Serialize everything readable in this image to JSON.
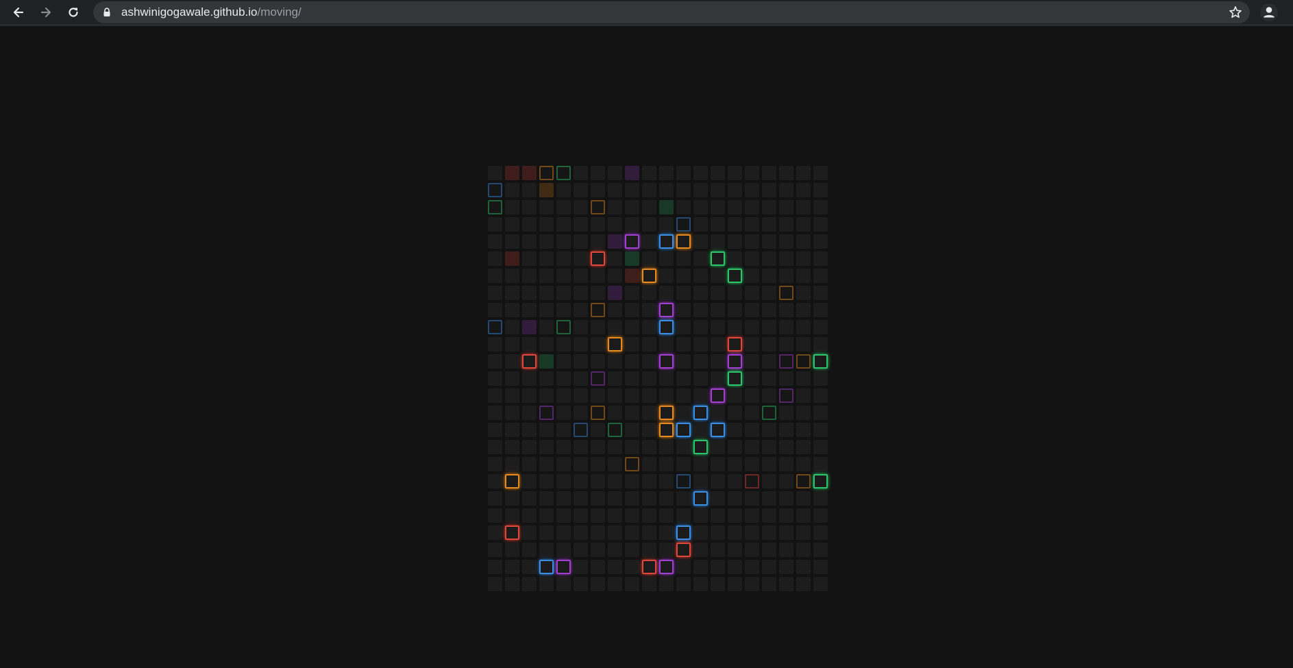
{
  "browser": {
    "url_host": "ashwinigogawale.github.io",
    "url_path": "/moving/",
    "icons": {
      "back": "back-arrow-icon",
      "forward": "forward-arrow-icon",
      "reload": "reload-icon",
      "lock": "lock-icon",
      "bookmark": "star-icon",
      "profile": "profile-icon"
    }
  },
  "grid": {
    "columns": 20,
    "rows": 25,
    "colors": {
      "r": "#e0463a",
      "o": "#e58a1f",
      "g": "#2ec56a",
      "b": "#3b8ee6",
      "p": "#a23fd0",
      "base": "#1d1d1d"
    },
    "cells": [
      [
        1,
        0,
        "r",
        "faint"
      ],
      [
        2,
        0,
        "r",
        "faint"
      ],
      [
        3,
        0,
        "o",
        "dim"
      ],
      [
        4,
        0,
        "g",
        "dim"
      ],
      [
        8,
        0,
        "p",
        "faint"
      ],
      [
        0,
        1,
        "b",
        "dim"
      ],
      [
        3,
        1,
        "o",
        "faint"
      ],
      [
        0,
        2,
        "g",
        "dim"
      ],
      [
        6,
        2,
        "o",
        "dim"
      ],
      [
        10,
        2,
        "g",
        "faint"
      ],
      [
        11,
        3,
        "b",
        "dim"
      ],
      [
        7,
        4,
        "p",
        "faint"
      ],
      [
        8,
        4,
        "p",
        "lit"
      ],
      [
        10,
        4,
        "b",
        "lit"
      ],
      [
        11,
        4,
        "o",
        "lit"
      ],
      [
        1,
        5,
        "r",
        "faint"
      ],
      [
        6,
        5,
        "r",
        "lit"
      ],
      [
        8,
        5,
        "g",
        "faint"
      ],
      [
        13,
        5,
        "g",
        "lit"
      ],
      [
        8,
        6,
        "r",
        "faint"
      ],
      [
        9,
        6,
        "o",
        "lit"
      ],
      [
        14,
        6,
        "g",
        "lit"
      ],
      [
        7,
        7,
        "p",
        "faint"
      ],
      [
        17,
        7,
        "o",
        "dim"
      ],
      [
        6,
        8,
        "o",
        "dim"
      ],
      [
        10,
        8,
        "p",
        "lit"
      ],
      [
        0,
        9,
        "b",
        "dim"
      ],
      [
        2,
        9,
        "p",
        "faint"
      ],
      [
        4,
        9,
        "g",
        "dim"
      ],
      [
        10,
        9,
        "b",
        "lit"
      ],
      [
        7,
        10,
        "o",
        "lit"
      ],
      [
        14,
        10,
        "r",
        "lit"
      ],
      [
        2,
        11,
        "r",
        "lit"
      ],
      [
        3,
        11,
        "g",
        "faint"
      ],
      [
        10,
        11,
        "p",
        "lit"
      ],
      [
        14,
        11,
        "p",
        "lit"
      ],
      [
        17,
        11,
        "p",
        "dim"
      ],
      [
        18,
        11,
        "o",
        "dim"
      ],
      [
        19,
        11,
        "g",
        "lit"
      ],
      [
        6,
        12,
        "p",
        "dim"
      ],
      [
        14,
        12,
        "g",
        "lit"
      ],
      [
        13,
        13,
        "p",
        "lit"
      ],
      [
        17,
        13,
        "p",
        "dim"
      ],
      [
        3,
        14,
        "p",
        "dim"
      ],
      [
        6,
        14,
        "o",
        "dim"
      ],
      [
        10,
        14,
        "o",
        "lit"
      ],
      [
        12,
        14,
        "b",
        "lit"
      ],
      [
        16,
        14,
        "g",
        "dim"
      ],
      [
        5,
        15,
        "b",
        "dim"
      ],
      [
        7,
        15,
        "g",
        "dim"
      ],
      [
        10,
        15,
        "o",
        "lit"
      ],
      [
        11,
        15,
        "b",
        "lit"
      ],
      [
        13,
        15,
        "b",
        "lit"
      ],
      [
        12,
        16,
        "g",
        "lit"
      ],
      [
        8,
        17,
        "o",
        "dim"
      ],
      [
        1,
        18,
        "o",
        "lit"
      ],
      [
        11,
        18,
        "b",
        "dim"
      ],
      [
        15,
        18,
        "r",
        "dim"
      ],
      [
        18,
        18,
        "o",
        "dim"
      ],
      [
        19,
        18,
        "g",
        "lit"
      ],
      [
        12,
        19,
        "b",
        "lit"
      ],
      [
        1,
        21,
        "r",
        "lit"
      ],
      [
        11,
        21,
        "b",
        "lit"
      ],
      [
        11,
        22,
        "r",
        "lit"
      ],
      [
        3,
        23,
        "b",
        "lit"
      ],
      [
        4,
        23,
        "p",
        "lit"
      ],
      [
        9,
        23,
        "r",
        "lit"
      ],
      [
        10,
        23,
        "p",
        "lit"
      ]
    ]
  }
}
